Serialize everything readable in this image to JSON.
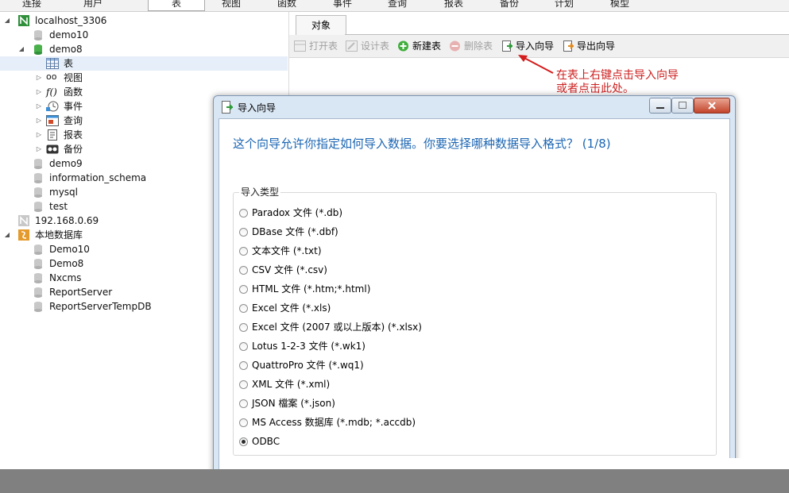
{
  "top_menu": {
    "items": [
      {
        "label": "连接"
      },
      {
        "label": "用户"
      },
      {
        "label": "表",
        "active": true
      },
      {
        "label": "视图"
      },
      {
        "label": "函数"
      },
      {
        "label": "事件"
      },
      {
        "label": "查询"
      },
      {
        "label": "报表"
      },
      {
        "label": "备份"
      },
      {
        "label": "计划"
      },
      {
        "label": "模型"
      }
    ]
  },
  "tree": {
    "conn1": {
      "label": "localhost_3306",
      "expanded": true
    },
    "conn1_dbs": {
      "demo10": "demo10",
      "demo8": "demo8"
    },
    "demo8_children": {
      "tables": "表",
      "views": "视图",
      "functions": "函数",
      "events": "事件",
      "queries": "查询",
      "reports": "报表",
      "backups": "备份"
    },
    "conn1_dbs_more": {
      "demo9": "demo9",
      "information_schema": "information_schema",
      "mysql": "mysql",
      "test": "test"
    },
    "conn2": {
      "label": "192.168.0.69"
    },
    "conn3": {
      "label": "本地数据库",
      "expanded": true
    },
    "conn3_dbs": {
      "Demo10": "Demo10",
      "Demo8": "Demo8",
      "Nxcms": "Nxcms",
      "ReportServer": "ReportServer",
      "ReportServerTempDB": "ReportServerTempDB"
    }
  },
  "objects": {
    "tab_label": "对象",
    "toolbar": {
      "open_table": "打开表",
      "design_table": "设计表",
      "new_table": "新建表",
      "delete_table": "删除表",
      "import_wizard": "导入向导",
      "export_wizard": "导出向导"
    }
  },
  "annotation": {
    "line1": "在表上右键点击导入向导",
    "line2": "或者点击此处。",
    "color": "#cc1f1f"
  },
  "dialog": {
    "title": "导入向导",
    "question": "这个向导允许你指定如何导入数据。你要选择哪种数据导入格式？ (1/8)",
    "group_label": "导入类型",
    "options": {
      "paradox": "Paradox 文件 (*.db)",
      "dbase": "DBase 文件 (*.dbf)",
      "text": "文本文件 (*.txt)",
      "csv": "CSV 文件 (*.csv)",
      "html": "HTML 文件 (*.htm;*.html)",
      "excel": "Excel 文件 (*.xls)",
      "excel2007": "Excel 文件 (2007 或以上版本) (*.xlsx)",
      "lotus": "Lotus 1-2-3 文件 (*.wk1)",
      "quattro": "QuattroPro 文件 (*.wq1)",
      "xml": "XML 文件 (*.xml)",
      "json": "JSON 檔案 (*.json)",
      "access": "MS Access 数据库 (*.mdb; *.accdb)",
      "odbc": "ODBC"
    },
    "selected_option": "ODBC",
    "accent_color": "#1c66b3"
  },
  "icons": [
    "connection-icon",
    "database-icon",
    "table-icon",
    "view-icon",
    "function-icon",
    "event-icon",
    "query-icon",
    "report-icon",
    "backup-icon",
    "import-icon",
    "export-icon",
    "add-icon",
    "delete-icon",
    "minimize-icon",
    "maximize-icon",
    "close-icon"
  ]
}
